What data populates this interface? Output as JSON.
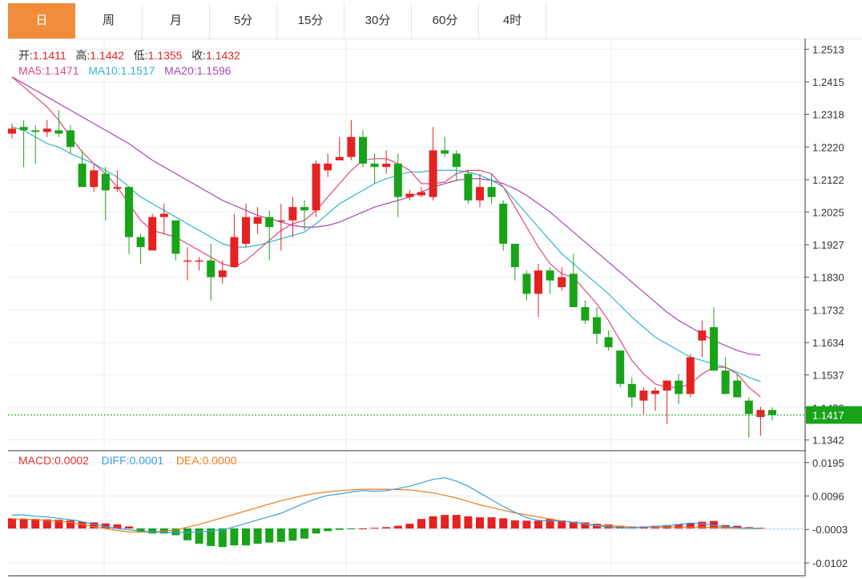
{
  "tabs": [
    "日",
    "周",
    "月",
    "5分",
    "15分",
    "30分",
    "60分",
    "4时"
  ],
  "active_tab": 0,
  "ohlc": {
    "open_label": "开:",
    "open": "1.1411",
    "high_label": "高:",
    "high": "1.1442",
    "low_label": "低:",
    "low": "1.1355",
    "close_label": "收:",
    "close": "1.1432"
  },
  "ma_legend": [
    {
      "label": "MA5:",
      "value": "1.1471",
      "color": "#e2487a"
    },
    {
      "label": "MA10:",
      "value": "1.1517",
      "color": "#33b6cc"
    },
    {
      "label": "MA20:",
      "value": "1.1596",
      "color": "#a64bb3"
    }
  ],
  "macd_legend": [
    {
      "label": "MACD:",
      "value": "0.0002",
      "color": "#e33030"
    },
    {
      "label": "DIFF:",
      "value": "0.0001",
      "color": "#3aa0e0"
    },
    {
      "label": "DEA:",
      "value": "0.0000",
      "color": "#f07d1e"
    }
  ],
  "colors": {
    "up": "#e52222",
    "down": "#19a319",
    "grid": "#e8eef3",
    "price_tag": "#19a319"
  },
  "chart_data": {
    "type": "candlestick",
    "price_axis": {
      "ticks": [
        "1.2513",
        "1.2415",
        "1.2318",
        "1.2220",
        "1.2122",
        "1.2025",
        "1.1927",
        "1.1830",
        "1.1732",
        "1.1634",
        "1.1537",
        "1.1439",
        "1.1342"
      ],
      "ylim": [
        1.131,
        1.2545
      ]
    },
    "current_price": "1.1417",
    "candles": [
      [
        1.226,
        1.229,
        1.2245,
        1.2275
      ],
      [
        1.228,
        1.23,
        1.216,
        1.227
      ],
      [
        1.227,
        1.2285,
        1.217,
        1.2265
      ],
      [
        1.2265,
        1.23,
        1.225,
        1.2275
      ],
      [
        1.227,
        1.233,
        1.225,
        1.226
      ],
      [
        1.227,
        1.2285,
        1.22,
        1.222
      ],
      [
        1.217,
        1.221,
        1.21,
        1.21
      ],
      [
        1.21,
        1.217,
        1.2085,
        1.215
      ],
      [
        1.214,
        1.216,
        1.2,
        1.209
      ],
      [
        1.2095,
        1.215,
        1.2085,
        1.21
      ],
      [
        1.21,
        1.21,
        1.19,
        1.195
      ],
      [
        1.195,
        1.196,
        1.187,
        1.192
      ],
      [
        1.191,
        1.202,
        1.191,
        1.201
      ],
      [
        1.201,
        1.205,
        1.196,
        1.202
      ],
      [
        1.2,
        1.2,
        1.188,
        1.19
      ],
      [
        1.188,
        1.192,
        1.182,
        1.188
      ],
      [
        1.188,
        1.189,
        1.185,
        1.188
      ],
      [
        1.188,
        1.193,
        1.176,
        1.183
      ],
      [
        1.183,
        1.188,
        1.181,
        1.185
      ],
      [
        1.186,
        1.202,
        1.186,
        1.195
      ],
      [
        1.193,
        1.205,
        1.192,
        1.201
      ],
      [
        1.199,
        1.204,
        1.196,
        1.201
      ],
      [
        1.201,
        1.203,
        1.188,
        1.198
      ],
      [
        1.2,
        1.205,
        1.191,
        1.2
      ],
      [
        1.2,
        1.207,
        1.195,
        1.204
      ],
      [
        1.204,
        1.206,
        1.197,
        1.203
      ],
      [
        1.203,
        1.218,
        1.201,
        1.217
      ],
      [
        1.215,
        1.22,
        1.213,
        1.217
      ],
      [
        1.218,
        1.225,
        1.218,
        1.219
      ],
      [
        1.219,
        1.23,
        1.218,
        1.225
      ],
      [
        1.225,
        1.227,
        1.216,
        1.217
      ],
      [
        1.217,
        1.22,
        1.211,
        1.216
      ],
      [
        1.216,
        1.221,
        1.214,
        1.217
      ],
      [
        1.217,
        1.22,
        1.201,
        1.207
      ],
      [
        1.207,
        1.209,
        1.206,
        1.208
      ],
      [
        1.2075,
        1.21,
        1.207,
        1.2085
      ],
      [
        1.207,
        1.228,
        1.206,
        1.221
      ],
      [
        1.221,
        1.225,
        1.219,
        1.22
      ],
      [
        1.22,
        1.221,
        1.212,
        1.216
      ],
      [
        1.214,
        1.215,
        1.205,
        1.206
      ],
      [
        1.206,
        1.214,
        1.204,
        1.21
      ],
      [
        1.21,
        1.214,
        1.205,
        1.207
      ],
      [
        1.205,
        1.206,
        1.191,
        1.193
      ],
      [
        1.193,
        1.193,
        1.182,
        1.186
      ],
      [
        1.184,
        1.185,
        1.176,
        1.178
      ],
      [
        1.178,
        1.187,
        1.171,
        1.185
      ],
      [
        1.185,
        1.186,
        1.178,
        1.182
      ],
      [
        1.18,
        1.186,
        1.179,
        1.183
      ],
      [
        1.184,
        1.19,
        1.174,
        1.174
      ],
      [
        1.174,
        1.176,
        1.169,
        1.17
      ],
      [
        1.171,
        1.174,
        1.163,
        1.166
      ],
      [
        1.165,
        1.167,
        1.161,
        1.162
      ],
      [
        1.161,
        1.161,
        1.15,
        1.151
      ],
      [
        1.151,
        1.153,
        1.144,
        1.147
      ],
      [
        1.146,
        1.15,
        1.142,
        1.149
      ],
      [
        1.148,
        1.15,
        1.143,
        1.149
      ],
      [
        1.149,
        1.152,
        1.139,
        1.152
      ],
      [
        1.152,
        1.154,
        1.145,
        1.148
      ],
      [
        1.148,
        1.16,
        1.147,
        1.159
      ],
      [
        1.164,
        1.17,
        1.159,
        1.167
      ],
      [
        1.168,
        1.174,
        1.155,
        1.155
      ],
      [
        1.155,
        1.159,
        1.148,
        1.148
      ],
      [
        1.152,
        1.154,
        1.147,
        1.147
      ],
      [
        1.146,
        1.147,
        1.135,
        1.142
      ],
      [
        1.1411,
        1.1442,
        1.1355,
        1.1432
      ],
      [
        1.1432,
        1.144,
        1.14,
        1.1417
      ]
    ],
    "ma5": [
      1.243,
      1.24,
      1.237,
      1.234,
      1.23,
      1.225,
      1.2205,
      1.217,
      1.214,
      1.21,
      1.205,
      1.2,
      1.197,
      1.196,
      1.195,
      1.193,
      1.191,
      1.189,
      1.187,
      1.186,
      1.188,
      1.191,
      1.194,
      1.197,
      1.199,
      1.2,
      1.203,
      1.207,
      1.211,
      1.215,
      1.218,
      1.2185,
      1.2185,
      1.217,
      1.215,
      1.211,
      1.211,
      1.2115,
      1.214,
      1.215,
      1.215,
      1.214,
      1.21,
      1.204,
      1.198,
      1.192,
      1.187,
      1.184,
      1.183,
      1.179,
      1.175,
      1.17,
      1.164,
      1.158,
      1.154,
      1.151,
      1.15,
      1.15,
      1.151,
      1.154,
      1.156,
      1.156,
      1.154,
      1.15,
      1.1471
    ],
    "ma10": [
      1.228,
      1.227,
      1.225,
      1.223,
      1.222,
      1.22,
      1.2185,
      1.217,
      1.215,
      1.213,
      1.21,
      1.207,
      1.205,
      1.203,
      1.201,
      1.199,
      1.197,
      1.195,
      1.193,
      1.192,
      1.192,
      1.1925,
      1.1935,
      1.1945,
      1.1955,
      1.1965,
      1.199,
      1.202,
      1.205,
      1.207,
      1.209,
      1.211,
      1.2125,
      1.2135,
      1.2145,
      1.2145,
      1.215,
      1.215,
      1.215,
      1.2145,
      1.2135,
      1.212,
      1.21,
      1.206,
      1.202,
      1.198,
      1.194,
      1.19,
      1.187,
      1.184,
      1.181,
      1.178,
      1.1745,
      1.171,
      1.168,
      1.165,
      1.163,
      1.161,
      1.159,
      1.158,
      1.157,
      1.156,
      1.1545,
      1.153,
      1.1517
    ],
    "ma20": [
      1.243,
      1.241,
      1.239,
      1.237,
      1.235,
      1.233,
      1.231,
      1.229,
      1.227,
      1.225,
      1.223,
      1.2205,
      1.218,
      1.216,
      1.214,
      1.212,
      1.21,
      1.208,
      1.206,
      1.2045,
      1.203,
      1.2015,
      1.2005,
      1.1995,
      1.1985,
      1.198,
      1.198,
      1.1985,
      1.1995,
      1.201,
      1.2025,
      1.204,
      1.205,
      1.206,
      1.207,
      1.2085,
      1.21,
      1.211,
      1.212,
      1.2125,
      1.2125,
      1.212,
      1.211,
      1.2095,
      1.2075,
      1.205,
      1.2025,
      1.1995,
      1.1965,
      1.1935,
      1.1905,
      1.1875,
      1.1845,
      1.1815,
      1.1785,
      1.1755,
      1.1725,
      1.17,
      1.168,
      1.166,
      1.164,
      1.1625,
      1.161,
      1.16,
      1.1596
    ],
    "macd_axis": {
      "ticks": [
        "0.0195",
        "0.0096",
        "-0.0003",
        "-0.0102"
      ],
      "ylim": [
        -0.014,
        0.023
      ]
    },
    "macd": [
      0.003,
      0.0028,
      0.0028,
      0.0027,
      0.0026,
      0.0024,
      0.002,
      0.0018,
      0.0015,
      0.0012,
      0.0006,
      -0.0012,
      -0.0015,
      -0.0015,
      -0.002,
      -0.0035,
      -0.0045,
      -0.0052,
      -0.0055,
      -0.005,
      -0.005,
      -0.0045,
      -0.0042,
      -0.004,
      -0.0036,
      -0.003,
      -0.0015,
      -0.0008,
      -0.0004,
      -0.0002,
      0.0,
      0.0002,
      0.0004,
      0.0008,
      0.0014,
      0.0028,
      0.0036,
      0.004,
      0.004,
      0.0036,
      0.0033,
      0.0033,
      0.003,
      0.0024,
      0.0023,
      0.0023,
      0.0028,
      0.0024,
      0.002,
      0.0018,
      0.0014,
      0.0012,
      0.0008,
      0.0006,
      0.0006,
      0.0008,
      0.001,
      0.0013,
      0.0016,
      0.002,
      0.0022,
      0.001,
      0.0008,
      0.0004,
      0.0002
    ],
    "diff": [
      0.004,
      0.004,
      0.0036,
      0.0034,
      0.003,
      0.0026,
      0.002,
      0.0012,
      0.0005,
      0.0,
      -0.0004,
      -0.0008,
      -0.001,
      -0.0012,
      -0.0012,
      -0.0012,
      -0.001,
      -0.0008,
      -0.0004,
      0.0005,
      0.0015,
      0.0025,
      0.0035,
      0.0045,
      0.006,
      0.0075,
      0.0088,
      0.0098,
      0.0102,
      0.0108,
      0.0112,
      0.011,
      0.0112,
      0.0118,
      0.0125,
      0.0135,
      0.0145,
      0.015,
      0.014,
      0.0125,
      0.0105,
      0.0085,
      0.0065,
      0.0048,
      0.0032,
      0.0024,
      0.0022,
      0.0022,
      0.0018,
      0.0013,
      0.0008,
      0.0004,
      0.0002,
      0.0002,
      0.0004,
      0.0006,
      0.0008,
      0.0012,
      0.0016,
      0.0014,
      0.001,
      0.0005,
      0.0002,
      0.0001,
      0.0001
    ],
    "dea": [
      0.0028,
      0.0028,
      0.0026,
      0.0024,
      0.0022,
      0.0018,
      0.0012,
      0.0005,
      0.0,
      -0.0006,
      -0.001,
      -0.0011,
      -0.001,
      -0.0008,
      -0.0004,
      0.0004,
      0.0012,
      0.0022,
      0.0032,
      0.0042,
      0.0052,
      0.0062,
      0.0072,
      0.0082,
      0.009,
      0.0098,
      0.0104,
      0.0108,
      0.0112,
      0.0114,
      0.0116,
      0.0116,
      0.0116,
      0.0115,
      0.0114,
      0.011,
      0.0105,
      0.0098,
      0.009,
      0.008,
      0.007,
      0.0062,
      0.0054,
      0.0046,
      0.004,
      0.0034,
      0.0028,
      0.0022,
      0.0018,
      0.0014,
      0.001,
      0.0008,
      0.0006,
      0.0004,
      0.0004,
      0.0004,
      0.0004,
      0.0004,
      0.0004,
      0.0004,
      0.0003,
      0.0002,
      0.0001,
      0.0,
      0.0
    ]
  }
}
